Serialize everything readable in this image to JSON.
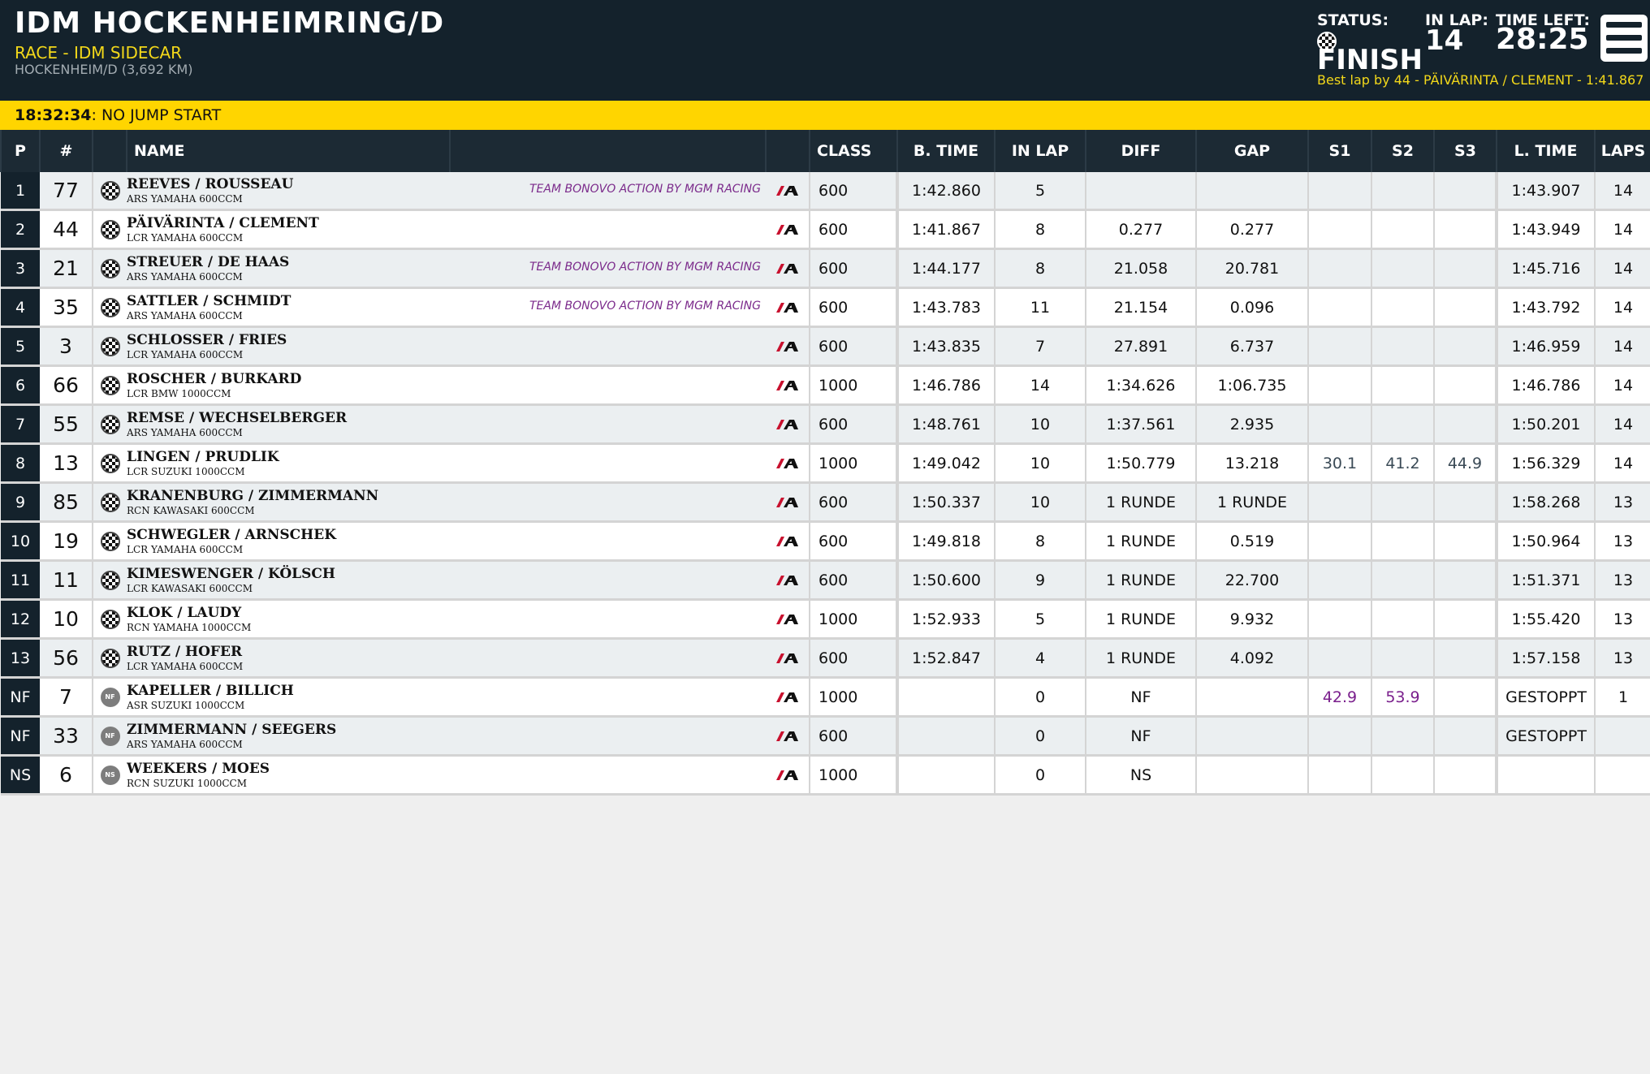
{
  "header": {
    "title": "IDM HOCKENHEIMRING/D",
    "session": "RACE - IDM SIDECAR",
    "track": "HOCKENHEIM/D (3,692 KM)",
    "status_label": "STATUS:",
    "status_value": "FINISH",
    "inlap_label": "IN LAP:",
    "inlap_value": "14",
    "timeleft_label": "TIME LEFT:",
    "timeleft_value": "28:25",
    "best_lap": "Best lap by 44 - PÄIVÄRINTA / CLEMENT - 1:41.867"
  },
  "message": {
    "time": "18:32:34",
    "text": ": NO JUMP START"
  },
  "columns": {
    "pos": "P",
    "num": "#",
    "name": "NAME",
    "class": "CLASS",
    "btime": "B. TIME",
    "inlap": "IN LAP",
    "diff": "DIFF",
    "gap": "GAP",
    "s1": "S1",
    "s2": "S2",
    "s3": "S3",
    "ltime": "L. TIME",
    "laps": "LAPS"
  },
  "colors": {
    "header_bg": "#14222c",
    "accent_yellow": "#ffd500",
    "team_purple": "#7b2a8b",
    "sector_purple": "#7a1f8c"
  },
  "rows": [
    {
      "pos": "1",
      "num": "77",
      "flag": "checkered",
      "name": "REEVES / ROUSSEAU",
      "bike": "ARS YAMAHA 600CCM",
      "team": "TEAM BONOVO ACTION BY MGM RACING",
      "class": "600",
      "btime": "1:42.860",
      "inlap": "5",
      "diff": "",
      "gap": "",
      "s1": "",
      "s2": "",
      "s3": "",
      "ltime": "1:43.907",
      "laps": "14"
    },
    {
      "pos": "2",
      "num": "44",
      "flag": "checkered",
      "name": "PÄIVÄRINTA / CLEMENT",
      "bike": "LCR YAMAHA 600CCM",
      "team": "",
      "class": "600",
      "btime": "1:41.867",
      "inlap": "8",
      "diff": "0.277",
      "gap": "0.277",
      "s1": "",
      "s2": "",
      "s3": "",
      "ltime": "1:43.949",
      "laps": "14"
    },
    {
      "pos": "3",
      "num": "21",
      "flag": "checkered",
      "name": "STREUER / DE HAAS",
      "bike": "ARS YAMAHA 600CCM",
      "team": "TEAM BONOVO ACTION BY MGM RACING",
      "class": "600",
      "btime": "1:44.177",
      "inlap": "8",
      "diff": "21.058",
      "gap": "20.781",
      "s1": "",
      "s2": "",
      "s3": "",
      "ltime": "1:45.716",
      "laps": "14"
    },
    {
      "pos": "4",
      "num": "35",
      "flag": "checkered",
      "name": "SATTLER / SCHMIDT",
      "bike": "ARS YAMAHA 600CCM",
      "team": "TEAM BONOVO ACTION BY MGM RACING",
      "class": "600",
      "btime": "1:43.783",
      "inlap": "11",
      "diff": "21.154",
      "gap": "0.096",
      "s1": "",
      "s2": "",
      "s3": "",
      "ltime": "1:43.792",
      "laps": "14"
    },
    {
      "pos": "5",
      "num": "3",
      "flag": "checkered",
      "name": "SCHLOSSER / FRIES",
      "bike": "LCR YAMAHA 600CCM",
      "team": "",
      "class": "600",
      "btime": "1:43.835",
      "inlap": "7",
      "diff": "27.891",
      "gap": "6.737",
      "s1": "",
      "s2": "",
      "s3": "",
      "ltime": "1:46.959",
      "laps": "14"
    },
    {
      "pos": "6",
      "num": "66",
      "flag": "checkered",
      "name": "ROSCHER / BURKARD",
      "bike": "LCR BMW 1000CCM",
      "team": "",
      "class": "1000",
      "btime": "1:46.786",
      "inlap": "14",
      "diff": "1:34.626",
      "gap": "1:06.735",
      "s1": "",
      "s2": "",
      "s3": "",
      "ltime": "1:46.786",
      "laps": "14"
    },
    {
      "pos": "7",
      "num": "55",
      "flag": "checkered",
      "name": "REMSE / WECHSELBERGER",
      "bike": "ARS YAMAHA 600CCM",
      "team": "",
      "class": "600",
      "btime": "1:48.761",
      "inlap": "10",
      "diff": "1:37.561",
      "gap": "2.935",
      "s1": "",
      "s2": "",
      "s3": "",
      "ltime": "1:50.201",
      "laps": "14"
    },
    {
      "pos": "8",
      "num": "13",
      "flag": "checkered",
      "name": "LINGEN / PRUDLIK",
      "bike": "LCR SUZUKI 1000CCM",
      "team": "",
      "class": "1000",
      "btime": "1:49.042",
      "inlap": "10",
      "diff": "1:50.779",
      "gap": "13.218",
      "s1": "30.1",
      "s2": "41.2",
      "s3": "44.9",
      "s_color": "sec-slate",
      "ltime": "1:56.329",
      "laps": "14"
    },
    {
      "pos": "9",
      "num": "85",
      "flag": "checkered",
      "name": "KRANENBURG / ZIMMERMANN",
      "bike": "RCN KAWASAKI 600CCM",
      "team": "",
      "class": "600",
      "btime": "1:50.337",
      "inlap": "10",
      "diff": "1 RUNDE",
      "gap": "1 RUNDE",
      "s1": "",
      "s2": "",
      "s3": "",
      "ltime": "1:58.268",
      "laps": "13"
    },
    {
      "pos": "10",
      "num": "19",
      "flag": "checkered",
      "name": "SCHWEGLER / ARNSCHEK",
      "bike": "LCR YAMAHA 600CCM",
      "team": "",
      "class": "600",
      "btime": "1:49.818",
      "inlap": "8",
      "diff": "1 RUNDE",
      "gap": "0.519",
      "s1": "",
      "s2": "",
      "s3": "",
      "ltime": "1:50.964",
      "laps": "13"
    },
    {
      "pos": "11",
      "num": "11",
      "flag": "checkered",
      "name": "KIMESWENGER / KÖLSCH",
      "bike": "LCR KAWASAKI 600CCM",
      "team": "",
      "class": "600",
      "btime": "1:50.600",
      "inlap": "9",
      "diff": "1 RUNDE",
      "gap": "22.700",
      "s1": "",
      "s2": "",
      "s3": "",
      "ltime": "1:51.371",
      "laps": "13"
    },
    {
      "pos": "12",
      "num": "10",
      "flag": "checkered",
      "name": "KLOK / LAUDY",
      "bike": "RCN YAMAHA 1000CCM",
      "team": "",
      "class": "1000",
      "btime": "1:52.933",
      "inlap": "5",
      "diff": "1 RUNDE",
      "gap": "9.932",
      "s1": "",
      "s2": "",
      "s3": "",
      "ltime": "1:55.420",
      "laps": "13"
    },
    {
      "pos": "13",
      "num": "56",
      "flag": "checkered",
      "name": "RUTZ / HOFER",
      "bike": "LCR YAMAHA 600CCM",
      "team": "",
      "class": "600",
      "btime": "1:52.847",
      "inlap": "4",
      "diff": "1 RUNDE",
      "gap": "4.092",
      "s1": "",
      "s2": "",
      "s3": "",
      "ltime": "1:57.158",
      "laps": "13"
    },
    {
      "pos": "NF",
      "num": "7",
      "flag": "NF",
      "name": "KAPELLER / BILLICH",
      "bike": "ASR SUZUKI 1000CCM",
      "team": "",
      "class": "1000",
      "btime": "",
      "inlap": "0",
      "diff": "NF",
      "gap": "",
      "s1": "42.9",
      "s2": "53.9",
      "s3": "",
      "s_color": "sec-purple",
      "ltime": "GESTOPPT",
      "laps": "1"
    },
    {
      "pos": "NF",
      "num": "33",
      "flag": "NF",
      "name": "ZIMMERMANN / SEEGERS",
      "bike": "ARS YAMAHA 600CCM",
      "team": "",
      "class": "600",
      "btime": "",
      "inlap": "0",
      "diff": "NF",
      "gap": "",
      "s1": "",
      "s2": "",
      "s3": "",
      "ltime": "GESTOPPT",
      "laps": ""
    },
    {
      "pos": "NS",
      "num": "6",
      "flag": "NS",
      "name": "WEEKERS / MOES",
      "bike": "RCN SUZUKI 1000CCM",
      "team": "",
      "class": "1000",
      "btime": "",
      "inlap": "0",
      "diff": "NS",
      "gap": "",
      "s1": "",
      "s2": "",
      "s3": "",
      "ltime": "",
      "laps": ""
    }
  ]
}
